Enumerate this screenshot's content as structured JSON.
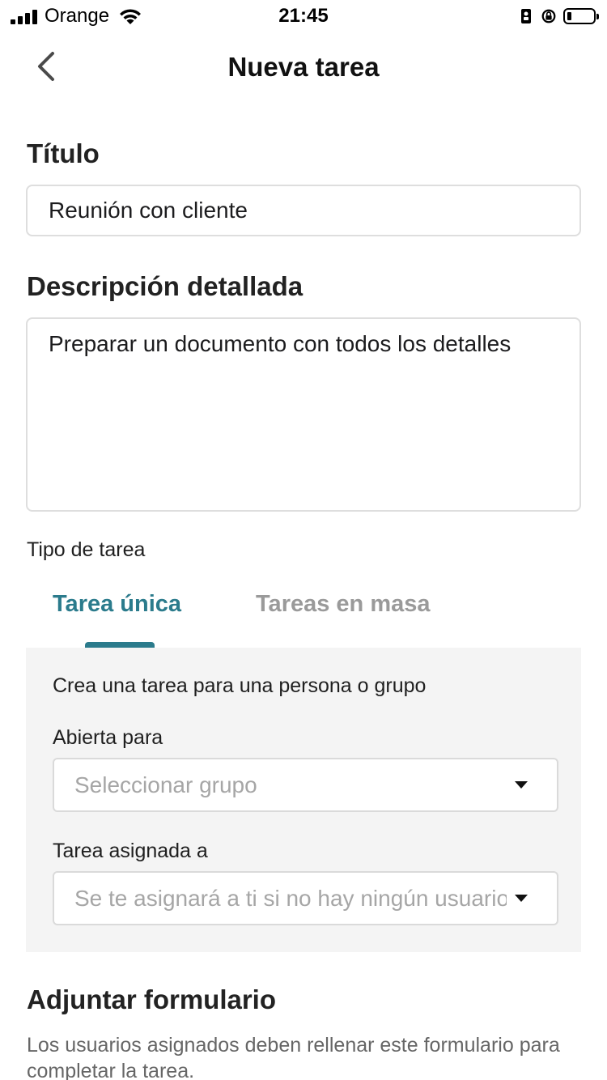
{
  "status_bar": {
    "carrier": "Orange",
    "time": "21:45",
    "icons": [
      "signal-icon",
      "wifi-icon",
      "portrait-lock-icon",
      "rotation-lock-icon",
      "battery-icon"
    ]
  },
  "nav": {
    "back_icon": "chevron-left-icon",
    "title": "Nueva tarea"
  },
  "form": {
    "title_label": "Título",
    "title_value": "Reunión con cliente",
    "description_label": "Descripción detallada",
    "description_value": "Preparar un documento con todos los detalles",
    "task_type_label": "Tipo de tarea",
    "tabs": [
      {
        "label": "Tarea única",
        "active": true
      },
      {
        "label": "Tareas en masa",
        "active": false
      }
    ],
    "panel": {
      "hint": "Crea una tarea para una persona o grupo",
      "open_for_label": "Abierta para",
      "open_for_placeholder": "Seleccionar grupo",
      "assigned_to_label": "Tarea asignada a",
      "assigned_to_placeholder": "Se te asignará a ti si no hay ningún usuario"
    },
    "attach_title": "Adjuntar formulario",
    "attach_description": "Los usuarios asignados deben rellenar este formulario para completar la tarea."
  },
  "colors": {
    "accent": "#2b7b8c",
    "inactive_tab": "#9a9a9a",
    "panel_bg": "#f4f4f4",
    "border": "#dedede"
  }
}
